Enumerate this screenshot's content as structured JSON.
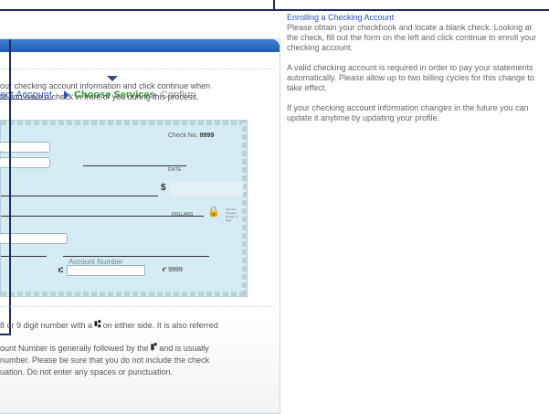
{
  "steps": {
    "step_1": "ect Account",
    "step_2": "Choose Services",
    "step_3": "Confirm"
  },
  "intro": {
    "line_1": "our checking account information and click continue when",
    "line_2": "at you have a check in front of you during this process."
  },
  "check": {
    "check_no_label": "Check No.",
    "check_no_value": "9999",
    "date_label": "DATE",
    "dollar_sign": "$",
    "dollars_label": "DOLLARS",
    "fine_print": "Security Features Details on back",
    "account_number_label": "Account Number",
    "check_number_mark": "⑈ 9999",
    "routing_symbol": "⑆"
  },
  "description": {
    "p1_line_1_pre": "8 or 9 digit number with a",
    "p1_line_1_post": "on either side. It is also referred",
    "p1_symbol": "⑆",
    "p2_line_1_pre": "ount Number is generally followed by the",
    "p2_line_1_post": "and is usually",
    "p2_symbol": "⑈",
    "p2_line_2": "number. Please be sure that you do not include the check",
    "p2_line_3": "uation.  Do not enter any spaces or punctuation."
  },
  "help": {
    "title": "Enrolling a Checking Account",
    "p1": "Please obtain your checkbook and locate a blank check. Looking at the check, fill out the form on the left and click continue to enroll your checking account.",
    "p2": "A valid checking account is required in order to pay your statements automatically. Please allow up to two billing cycles for this change to take effect.",
    "p3": "If your checking account information changes in the future you can update it anytime by updating your profile."
  },
  "colors": {
    "header_blue": "#1f5fb7",
    "active_step_green": "#2e9a2e",
    "link_blue": "#2a52be",
    "check_background": "#d6ecf4"
  }
}
